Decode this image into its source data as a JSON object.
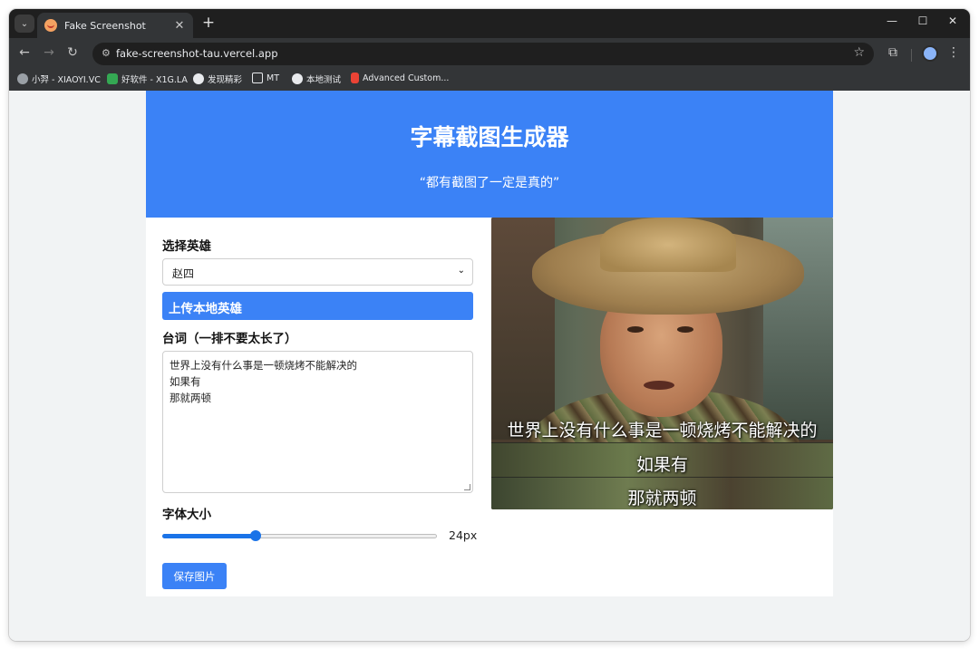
{
  "browser": {
    "tab_title": "Fake Screenshot",
    "tab_close_glyph": "✕",
    "new_tab_glyph": "+",
    "url": "fake-screenshot-tau.vercel.app",
    "bookmarks": [
      {
        "label": "小羿 - XIAOYI.VC",
        "icon_color": "#9aa0a6"
      },
      {
        "label": "好软件 - X1G.LA",
        "icon_color": "#34a853"
      },
      {
        "label": "发现精彩",
        "icon_color": "#e8eaed"
      },
      {
        "label": "MT",
        "icon_color": "#e8eaed"
      },
      {
        "label": "本地测试",
        "icon_color": "#e8eaed"
      },
      {
        "label": "Advanced Custom...",
        "icon_color": "#ea4335"
      }
    ]
  },
  "page": {
    "title": "字幕截图生成器",
    "subtitle": "“都有截图了一定是真的”",
    "hero_label": "选择英雄",
    "hero_value": "赵四",
    "upload_label": "上传本地英雄",
    "lines_label": "台词（一排不要太长了）",
    "lines": [
      "世界上没有什么事是一顿烧烤不能解决的",
      "如果有",
      "那就两顿"
    ],
    "font_size_label": "字体大小",
    "font_size_value": "24px",
    "font_size_fraction": 0.34,
    "save_label": "保存图片"
  },
  "preview": {
    "captions": [
      "世界上没有什么事是一顿烧烤不能解决的",
      "如果有",
      "那就两顿"
    ]
  },
  "colors": {
    "accent": "#3b82f6",
    "slider": "#1a73e8"
  }
}
